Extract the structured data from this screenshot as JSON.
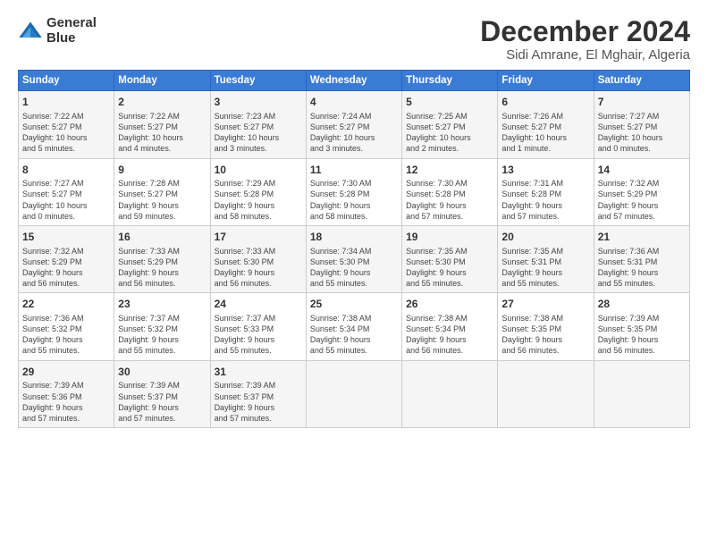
{
  "logo": {
    "line1": "General",
    "line2": "Blue"
  },
  "title": "December 2024",
  "subtitle": "Sidi Amrane, El Mghair, Algeria",
  "headers": [
    "Sunday",
    "Monday",
    "Tuesday",
    "Wednesday",
    "Thursday",
    "Friday",
    "Saturday"
  ],
  "weeks": [
    [
      {
        "day": "1",
        "info": "Sunrise: 7:22 AM\nSunset: 5:27 PM\nDaylight: 10 hours\nand 5 minutes."
      },
      {
        "day": "2",
        "info": "Sunrise: 7:22 AM\nSunset: 5:27 PM\nDaylight: 10 hours\nand 4 minutes."
      },
      {
        "day": "3",
        "info": "Sunrise: 7:23 AM\nSunset: 5:27 PM\nDaylight: 10 hours\nand 3 minutes."
      },
      {
        "day": "4",
        "info": "Sunrise: 7:24 AM\nSunset: 5:27 PM\nDaylight: 10 hours\nand 3 minutes."
      },
      {
        "day": "5",
        "info": "Sunrise: 7:25 AM\nSunset: 5:27 PM\nDaylight: 10 hours\nand 2 minutes."
      },
      {
        "day": "6",
        "info": "Sunrise: 7:26 AM\nSunset: 5:27 PM\nDaylight: 10 hours\nand 1 minute."
      },
      {
        "day": "7",
        "info": "Sunrise: 7:27 AM\nSunset: 5:27 PM\nDaylight: 10 hours\nand 0 minutes."
      }
    ],
    [
      {
        "day": "8",
        "info": "Sunrise: 7:27 AM\nSunset: 5:27 PM\nDaylight: 10 hours\nand 0 minutes."
      },
      {
        "day": "9",
        "info": "Sunrise: 7:28 AM\nSunset: 5:27 PM\nDaylight: 9 hours\nand 59 minutes."
      },
      {
        "day": "10",
        "info": "Sunrise: 7:29 AM\nSunset: 5:28 PM\nDaylight: 9 hours\nand 58 minutes."
      },
      {
        "day": "11",
        "info": "Sunrise: 7:30 AM\nSunset: 5:28 PM\nDaylight: 9 hours\nand 58 minutes."
      },
      {
        "day": "12",
        "info": "Sunrise: 7:30 AM\nSunset: 5:28 PM\nDaylight: 9 hours\nand 57 minutes."
      },
      {
        "day": "13",
        "info": "Sunrise: 7:31 AM\nSunset: 5:28 PM\nDaylight: 9 hours\nand 57 minutes."
      },
      {
        "day": "14",
        "info": "Sunrise: 7:32 AM\nSunset: 5:29 PM\nDaylight: 9 hours\nand 57 minutes."
      }
    ],
    [
      {
        "day": "15",
        "info": "Sunrise: 7:32 AM\nSunset: 5:29 PM\nDaylight: 9 hours\nand 56 minutes."
      },
      {
        "day": "16",
        "info": "Sunrise: 7:33 AM\nSunset: 5:29 PM\nDaylight: 9 hours\nand 56 minutes."
      },
      {
        "day": "17",
        "info": "Sunrise: 7:33 AM\nSunset: 5:30 PM\nDaylight: 9 hours\nand 56 minutes."
      },
      {
        "day": "18",
        "info": "Sunrise: 7:34 AM\nSunset: 5:30 PM\nDaylight: 9 hours\nand 55 minutes."
      },
      {
        "day": "19",
        "info": "Sunrise: 7:35 AM\nSunset: 5:30 PM\nDaylight: 9 hours\nand 55 minutes."
      },
      {
        "day": "20",
        "info": "Sunrise: 7:35 AM\nSunset: 5:31 PM\nDaylight: 9 hours\nand 55 minutes."
      },
      {
        "day": "21",
        "info": "Sunrise: 7:36 AM\nSunset: 5:31 PM\nDaylight: 9 hours\nand 55 minutes."
      }
    ],
    [
      {
        "day": "22",
        "info": "Sunrise: 7:36 AM\nSunset: 5:32 PM\nDaylight: 9 hours\nand 55 minutes."
      },
      {
        "day": "23",
        "info": "Sunrise: 7:37 AM\nSunset: 5:32 PM\nDaylight: 9 hours\nand 55 minutes."
      },
      {
        "day": "24",
        "info": "Sunrise: 7:37 AM\nSunset: 5:33 PM\nDaylight: 9 hours\nand 55 minutes."
      },
      {
        "day": "25",
        "info": "Sunrise: 7:38 AM\nSunset: 5:34 PM\nDaylight: 9 hours\nand 55 minutes."
      },
      {
        "day": "26",
        "info": "Sunrise: 7:38 AM\nSunset: 5:34 PM\nDaylight: 9 hours\nand 56 minutes."
      },
      {
        "day": "27",
        "info": "Sunrise: 7:38 AM\nSunset: 5:35 PM\nDaylight: 9 hours\nand 56 minutes."
      },
      {
        "day": "28",
        "info": "Sunrise: 7:39 AM\nSunset: 5:35 PM\nDaylight: 9 hours\nand 56 minutes."
      }
    ],
    [
      {
        "day": "29",
        "info": "Sunrise: 7:39 AM\nSunset: 5:36 PM\nDaylight: 9 hours\nand 57 minutes."
      },
      {
        "day": "30",
        "info": "Sunrise: 7:39 AM\nSunset: 5:37 PM\nDaylight: 9 hours\nand 57 minutes."
      },
      {
        "day": "31",
        "info": "Sunrise: 7:39 AM\nSunset: 5:37 PM\nDaylight: 9 hours\nand 57 minutes."
      },
      {
        "day": "",
        "info": ""
      },
      {
        "day": "",
        "info": ""
      },
      {
        "day": "",
        "info": ""
      },
      {
        "day": "",
        "info": ""
      }
    ]
  ]
}
